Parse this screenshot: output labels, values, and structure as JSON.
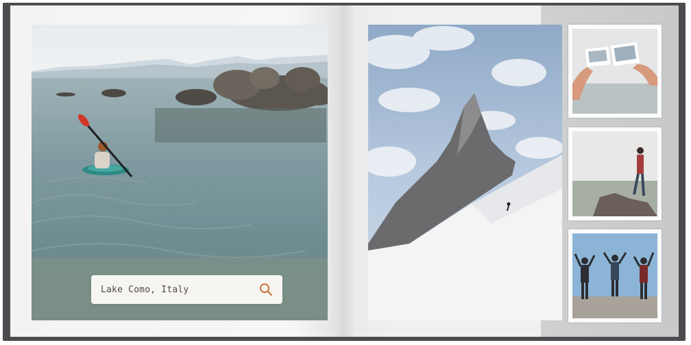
{
  "caption": {
    "text": "Lake Como, Italy",
    "icon": "search-icon",
    "accent_color": "#c9753a"
  },
  "colors": {
    "cover": "#4a4c4f",
    "page": "#f3f3f3",
    "panel": "#cbcccd"
  }
}
